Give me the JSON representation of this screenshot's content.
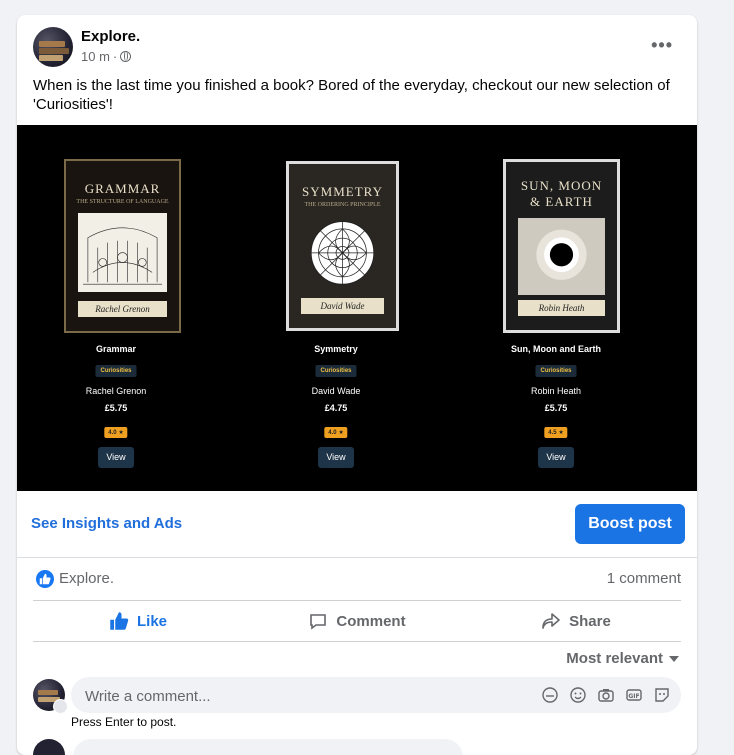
{
  "post": {
    "page_name": "Explore.",
    "time": "10 m",
    "separator": "·",
    "more_icon": "more-horizontal-icon",
    "text": "When is the last time you finished a book? Bored of the everyday, checkout our new selection of 'Curiosities'!"
  },
  "books": [
    {
      "cover_title": "GRAMMAR",
      "cover_subtitle": "THE STRUCTURE OF LANGUAGE",
      "cover_author": "Rachel Grenon",
      "name": "Grammar",
      "tag": "Curiosities",
      "author": "Rachel Grenon",
      "price": "£5.75",
      "rating": "4.0 ★",
      "view_label": "View"
    },
    {
      "cover_title": "SYMMETRY",
      "cover_subtitle": "THE ORDERING PRINCIPLE",
      "cover_author": "David Wade",
      "name": "Symmetry",
      "tag": "Curiosities",
      "author": "David Wade",
      "price": "£4.75",
      "rating": "4.0 ★",
      "view_label": "View"
    },
    {
      "cover_title": "SUN, MOON & EARTH",
      "cover_subtitle": "",
      "cover_author": "Robin Heath",
      "name": "Sun, Moon and Earth",
      "tag": "Curiosities",
      "author": "Robin Heath",
      "price": "£5.75",
      "rating": "4.5 ★",
      "view_label": "View"
    }
  ],
  "insights": {
    "link": "See Insights and Ads",
    "boost": "Boost post"
  },
  "reactions": {
    "name": "Explore.",
    "comments": "1 comment"
  },
  "actions": {
    "like": "Like",
    "comment": "Comment",
    "share": "Share"
  },
  "sort": {
    "label": "Most relevant"
  },
  "comment_box": {
    "placeholder": "Write a comment...",
    "hint": "Press Enter to post."
  },
  "colors": {
    "accent": "#1b74e4",
    "link": "#216fdb",
    "muted": "#65676b"
  }
}
